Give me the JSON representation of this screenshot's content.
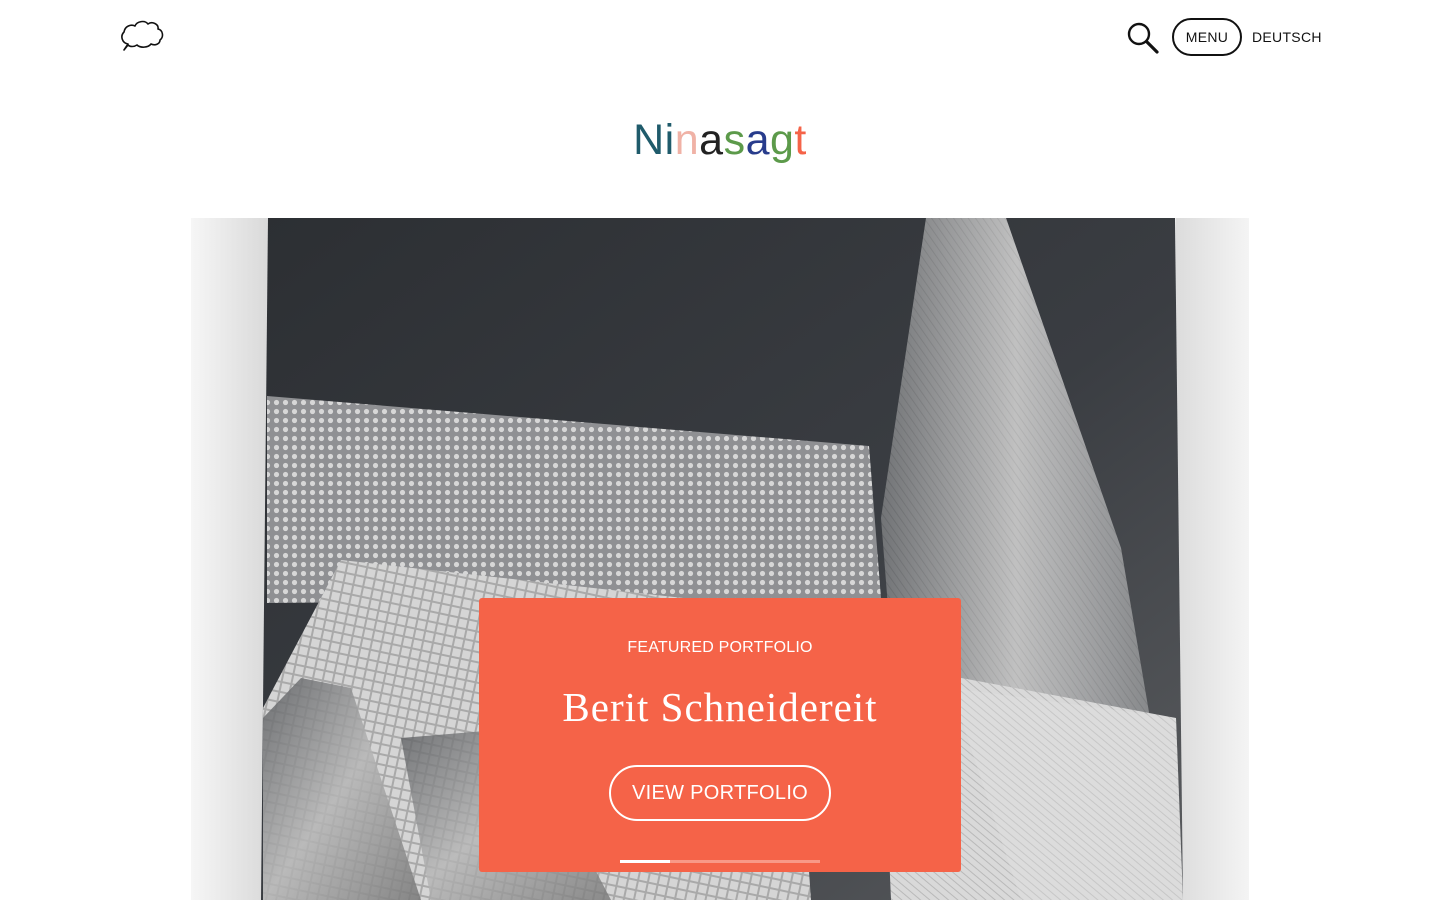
{
  "header": {
    "logo_icon": "cloud-speech-bubble-icon",
    "search_icon": "search-icon",
    "menu_label": "MENU",
    "language_label": "DEUTSCH"
  },
  "site_title": {
    "letters": [
      {
        "char": "N",
        "color": "#1f5b6b"
      },
      {
        "char": "i",
        "color": "#1f5b6b"
      },
      {
        "char": "n",
        "color": "#f0b2a6"
      },
      {
        "char": "a",
        "color": "#222222"
      },
      {
        "char": "s",
        "color": "#5c9a4a"
      },
      {
        "char": "a",
        "color": "#283c8c"
      },
      {
        "char": "g",
        "color": "#5c9a4a"
      },
      {
        "char": "t",
        "color": "#f56348"
      }
    ]
  },
  "featured": {
    "label": "FEATURED PORTFOLIO",
    "title": "Berit Schneidereit",
    "button_label": "VIEW PORTFOLIO",
    "card_color": "#f56348",
    "slide_progress": 0.25
  }
}
